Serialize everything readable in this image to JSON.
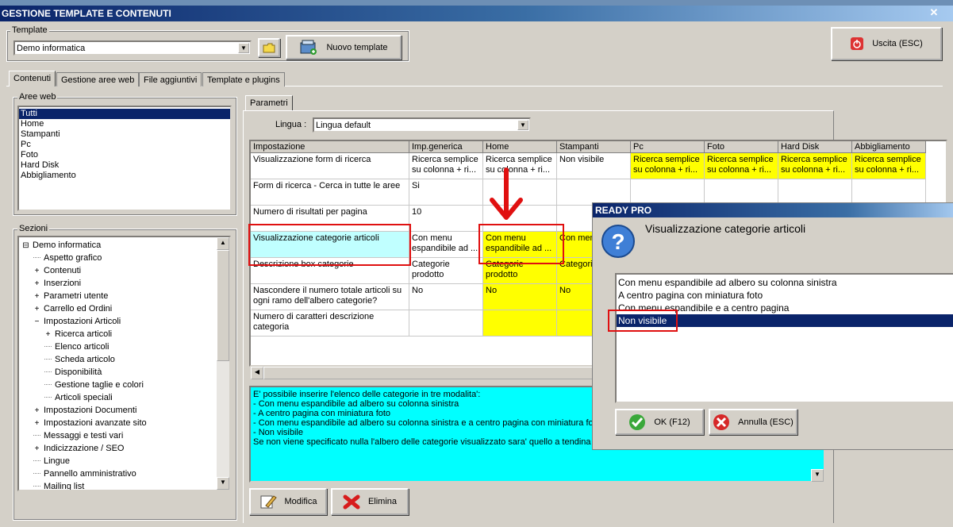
{
  "window": {
    "title": "GESTIONE TEMPLATE E CONTENUTI",
    "close": "✕"
  },
  "template": {
    "legend": "Template",
    "selected": "Demo informatica",
    "new_button": "Nuovo template"
  },
  "exit_button": "Uscita (ESC)",
  "tabs": [
    "Contenuti",
    "Gestione aree web",
    "File aggiuntivi",
    "Template e plugins"
  ],
  "aree_web": {
    "legend": "Aree web",
    "items": [
      "Tutti",
      "Home",
      "Stampanti",
      "Pc",
      "Foto",
      "Hard Disk",
      "Abbigliamento"
    ],
    "selected_index": 0
  },
  "sezioni": {
    "legend": "Sezioni",
    "items": [
      {
        "label": "Demo informatica",
        "exp": "⊟",
        "level": 0
      },
      {
        "label": "Aspetto grafico",
        "exp": "",
        "level": 1
      },
      {
        "label": "Contenuti",
        "exp": "+",
        "level": 1
      },
      {
        "label": "Inserzioni",
        "exp": "+",
        "level": 1
      },
      {
        "label": "Parametri utente",
        "exp": "+",
        "level": 1
      },
      {
        "label": "Carrello ed Ordini",
        "exp": "+",
        "level": 1
      },
      {
        "label": "Impostazioni Articoli",
        "exp": "-",
        "level": 1
      },
      {
        "label": "Ricerca articoli",
        "exp": "+",
        "level": 2
      },
      {
        "label": "Elenco articoli",
        "exp": "",
        "level": 2
      },
      {
        "label": "Scheda articolo",
        "exp": "",
        "level": 2
      },
      {
        "label": "Disponibilità",
        "exp": "",
        "level": 2
      },
      {
        "label": "Gestione taglie e colori",
        "exp": "",
        "level": 2
      },
      {
        "label": "Articoli speciali",
        "exp": "",
        "level": 2
      },
      {
        "label": "Impostazioni Documenti",
        "exp": "+",
        "level": 1
      },
      {
        "label": "Impostazioni avanzate sito",
        "exp": "+",
        "level": 1
      },
      {
        "label": "Messaggi e testi vari",
        "exp": "",
        "level": 1
      },
      {
        "label": "Indicizzazione / SEO",
        "exp": "+",
        "level": 1
      },
      {
        "label": "Lingue",
        "exp": "",
        "level": 1
      },
      {
        "label": "Pannello amministrativo",
        "exp": "",
        "level": 1
      },
      {
        "label": "Mailing list",
        "exp": "",
        "level": 1
      }
    ]
  },
  "parametri": {
    "tab": "Parametri",
    "lingua_label": "Lingua :",
    "lingua_value": "Lingua default",
    "columns": [
      "Impostazione",
      "Imp.generica",
      "Home",
      "Stampanti",
      "Pc",
      "Foto",
      "Hard Disk",
      "Abbigliamento"
    ],
    "rows": [
      {
        "setting": "Visualizzazione form di ricerca",
        "cells": [
          "Ricerca semplice su colonna + ri...",
          "Ricerca semplice su colonna + ri...",
          "Non visibile",
          "Ricerca semplice su colonna + ri...",
          "Ricerca semplice su colonna + ri...",
          "Ricerca semplice su colonna + ri...",
          "Ricerca semplice su colonna + ri..."
        ]
      },
      {
        "setting": "Form di ricerca - Cerca in tutte le aree",
        "cells": [
          "Si",
          "",
          "",
          "",
          "",
          "",
          ""
        ]
      },
      {
        "setting": "Numero di risultati per pagina",
        "cells": [
          "10",
          "",
          "",
          "",
          "",
          "",
          ""
        ]
      },
      {
        "setting": "Visualizzazione categorie articoli",
        "cells": [
          "Con menu espandibile ad ...",
          "Con menu espandibile ad ...",
          "Con menu",
          "",
          "",
          "",
          ""
        ]
      },
      {
        "setting": "Descrizione box categorie",
        "cells": [
          "Categorie prodotto",
          "Categorie prodotto",
          "Categorie",
          "",
          "",
          "",
          ""
        ]
      },
      {
        "setting": "Nascondere il numero totale articoli su ogni ramo dell'albero categorie?",
        "cells": [
          "No",
          "No",
          "No",
          "",
          "",
          "",
          ""
        ]
      },
      {
        "setting": "Numero di caratteri descrizione categoria",
        "cells": [
          "",
          "",
          "",
          "",
          "",
          "",
          ""
        ]
      }
    ],
    "description": [
      "E' possibile inserire l'elenco delle categorie in tre modalita':",
      "- Con menu espandibile ad albero su colonna sinistra",
      "- A centro pagina con miniatura foto",
      "- Con menu espandibile ad albero su colonna sinistra e a centro pagina con miniatura foto",
      "- Non visibile",
      "Se non viene specificato nulla l'albero delle categorie visualizzato sara' quello a tendina ne"
    ],
    "modifica_button": "Modifica",
    "elimina_button": "Elimina"
  },
  "dialog": {
    "title": "READY PRO",
    "heading": "Visualizzazione categorie articoli",
    "options": [
      "Con menu espandibile ad albero su colonna sinistra",
      "A centro pagina con miniatura foto",
      "Con menu espandibile e a centro pagina",
      "Non visibile"
    ],
    "selected_index": 3,
    "ok_button": "OK (F12)",
    "cancel_button": "Annulla (ESC)"
  },
  "colors": {
    "highlight": "#ffff00",
    "selected_row": "#c0ffff",
    "annotation": "#e01010",
    "description_bg": "#00ffff"
  }
}
